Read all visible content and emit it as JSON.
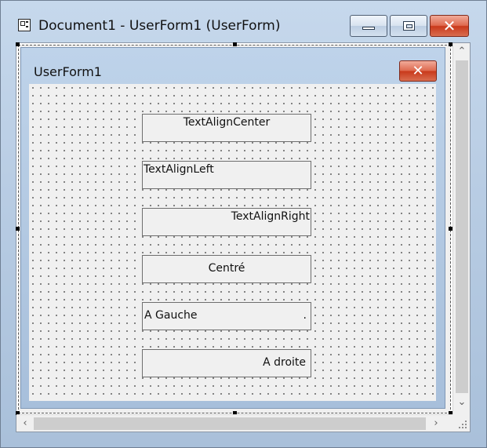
{
  "window": {
    "title": "Document1 - UserForm1 (UserForm)",
    "minimize_icon": "minimize-icon",
    "maximize_icon": "maximize-icon",
    "close_icon": "close-icon",
    "close_glyph": "✕"
  },
  "userform": {
    "title": "UserForm1",
    "close_glyph": "✕",
    "textboxes": [
      {
        "text": "TextAlignCenter",
        "align": "center"
      },
      {
        "text": "TextAlignLeft",
        "align": "left"
      },
      {
        "text": "TextAlignRight",
        "align": "right"
      },
      {
        "text": "Centré",
        "align": "center"
      },
      {
        "text": "A Gauche",
        "suffix": ".",
        "align": "left"
      },
      {
        "text": "A droite",
        "align": "right"
      }
    ]
  },
  "scrollbars": {
    "up_glyph": "⌃",
    "down_glyph": "⌄",
    "left_glyph": "‹",
    "right_glyph": "›"
  },
  "colors": {
    "title_bar": "#b9cde4",
    "close_button": "#c9391b",
    "form_background": "#f0f0f0"
  }
}
